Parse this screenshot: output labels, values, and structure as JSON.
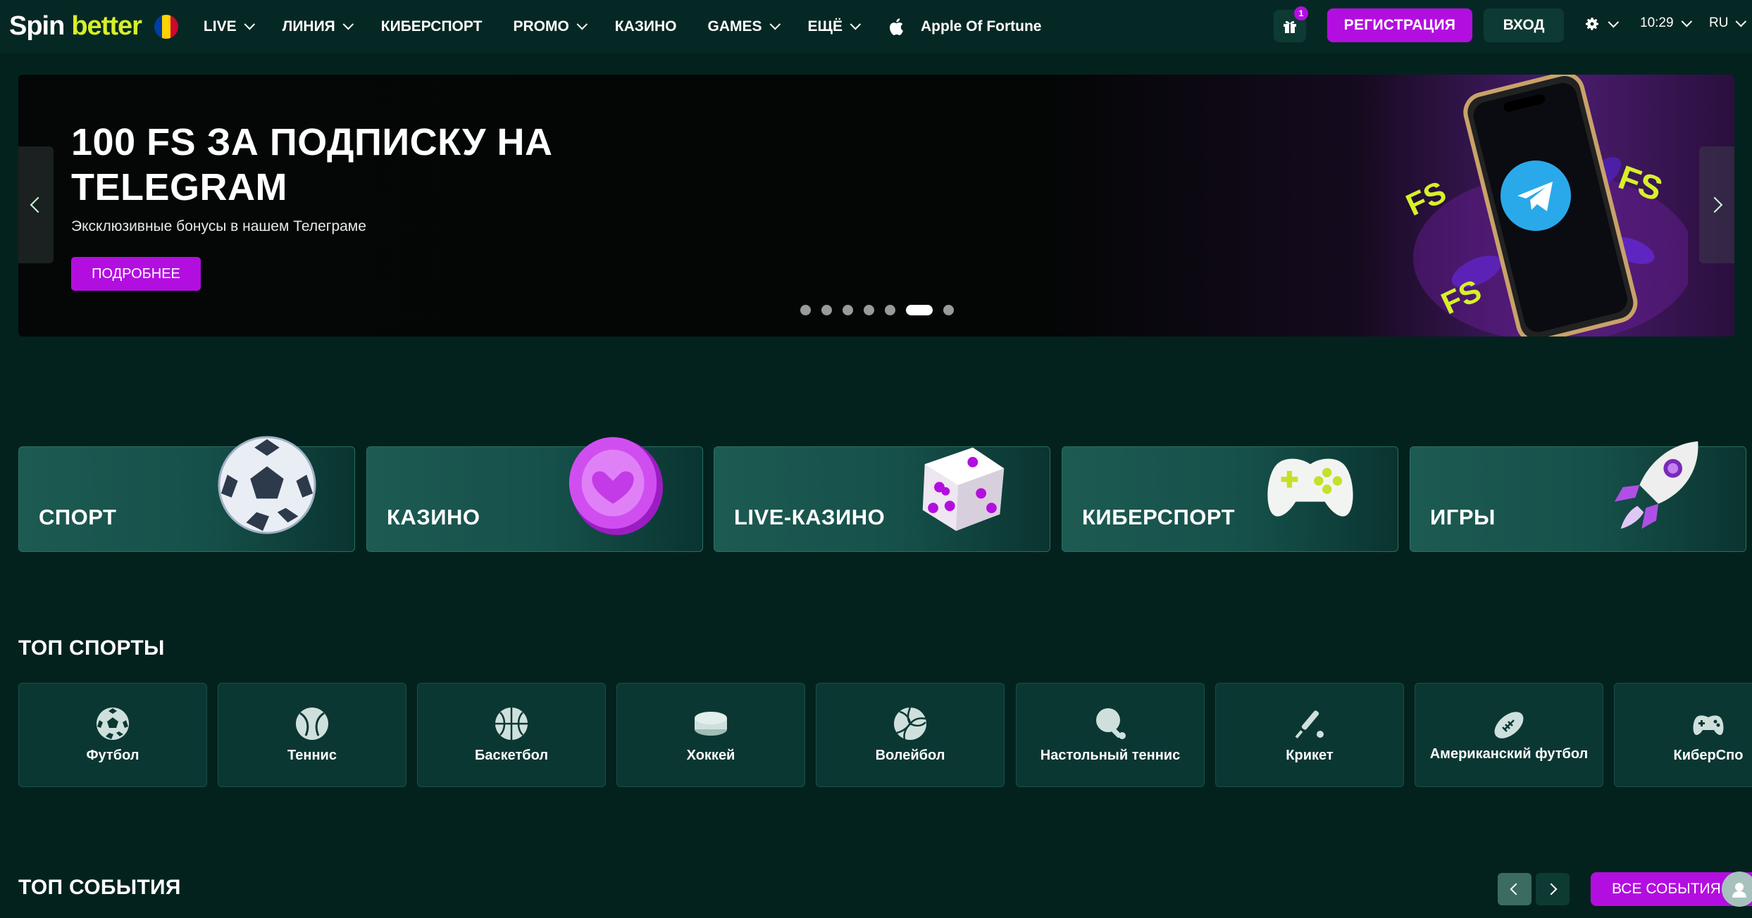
{
  "brand": {
    "name_part1": "Spin",
    "name_part2": "better",
    "accent": "#d7f029",
    "primary": "#b30ee0"
  },
  "nav": {
    "items": [
      {
        "label": "LIVE",
        "dropdown": true
      },
      {
        "label": "ЛИНИЯ",
        "dropdown": true
      },
      {
        "label": "КИБЕРСПОРТ",
        "dropdown": false
      },
      {
        "label": "PROMO",
        "dropdown": true
      },
      {
        "label": "КАЗИНО",
        "dropdown": false
      },
      {
        "label": "GAMES",
        "dropdown": true
      },
      {
        "label": "ЕЩЁ",
        "dropdown": true
      }
    ],
    "featured_game": "Apple Of Fortune"
  },
  "header": {
    "gift_badge": "1",
    "register_label": "РЕГИСТРАЦИЯ",
    "login_label": "ВХОД",
    "time": "10:29",
    "language": "RU"
  },
  "banner": {
    "title": "100 FS ЗА ПОДПИСКУ НА TELEGRAM",
    "subtitle": "Эксклюзивные бонусы в нашем Телеграме",
    "button_label": "ПОДРОБНЕЕ",
    "art_text": [
      "FS",
      "FS",
      "FS"
    ],
    "slides_count": 7,
    "active_slide": 6
  },
  "categories": [
    {
      "label": "СПОРТ",
      "icon": "soccer-ball-icon"
    },
    {
      "label": "КАЗИНО",
      "icon": "casino-chip-icon"
    },
    {
      "label": "LIVE-КАЗИНО",
      "icon": "dice-icon"
    },
    {
      "label": "КИБЕРСПОРТ",
      "icon": "gamepad-icon"
    },
    {
      "label": "ИГРЫ",
      "icon": "rocket-icon"
    }
  ],
  "top_sports": {
    "title": "ТОП СПОРТЫ",
    "items": [
      {
        "label": "Футбол",
        "icon": "football-icon"
      },
      {
        "label": "Теннис",
        "icon": "tennis-icon"
      },
      {
        "label": "Баскетбол",
        "icon": "basketball-icon"
      },
      {
        "label": "Хоккей",
        "icon": "hockey-puck-icon"
      },
      {
        "label": "Волейбол",
        "icon": "volleyball-icon"
      },
      {
        "label": "Настольный теннис",
        "icon": "table-tennis-icon"
      },
      {
        "label": "Крикет",
        "icon": "cricket-icon"
      },
      {
        "label": "Американский футбол",
        "icon": "american-football-icon"
      },
      {
        "label": "КиберСпо",
        "icon": "esports-gamepad-icon"
      }
    ]
  },
  "top_events": {
    "title": "ТОП СОБЫТИЯ",
    "all_label": "ВСЕ СОБЫТИЯ"
  }
}
